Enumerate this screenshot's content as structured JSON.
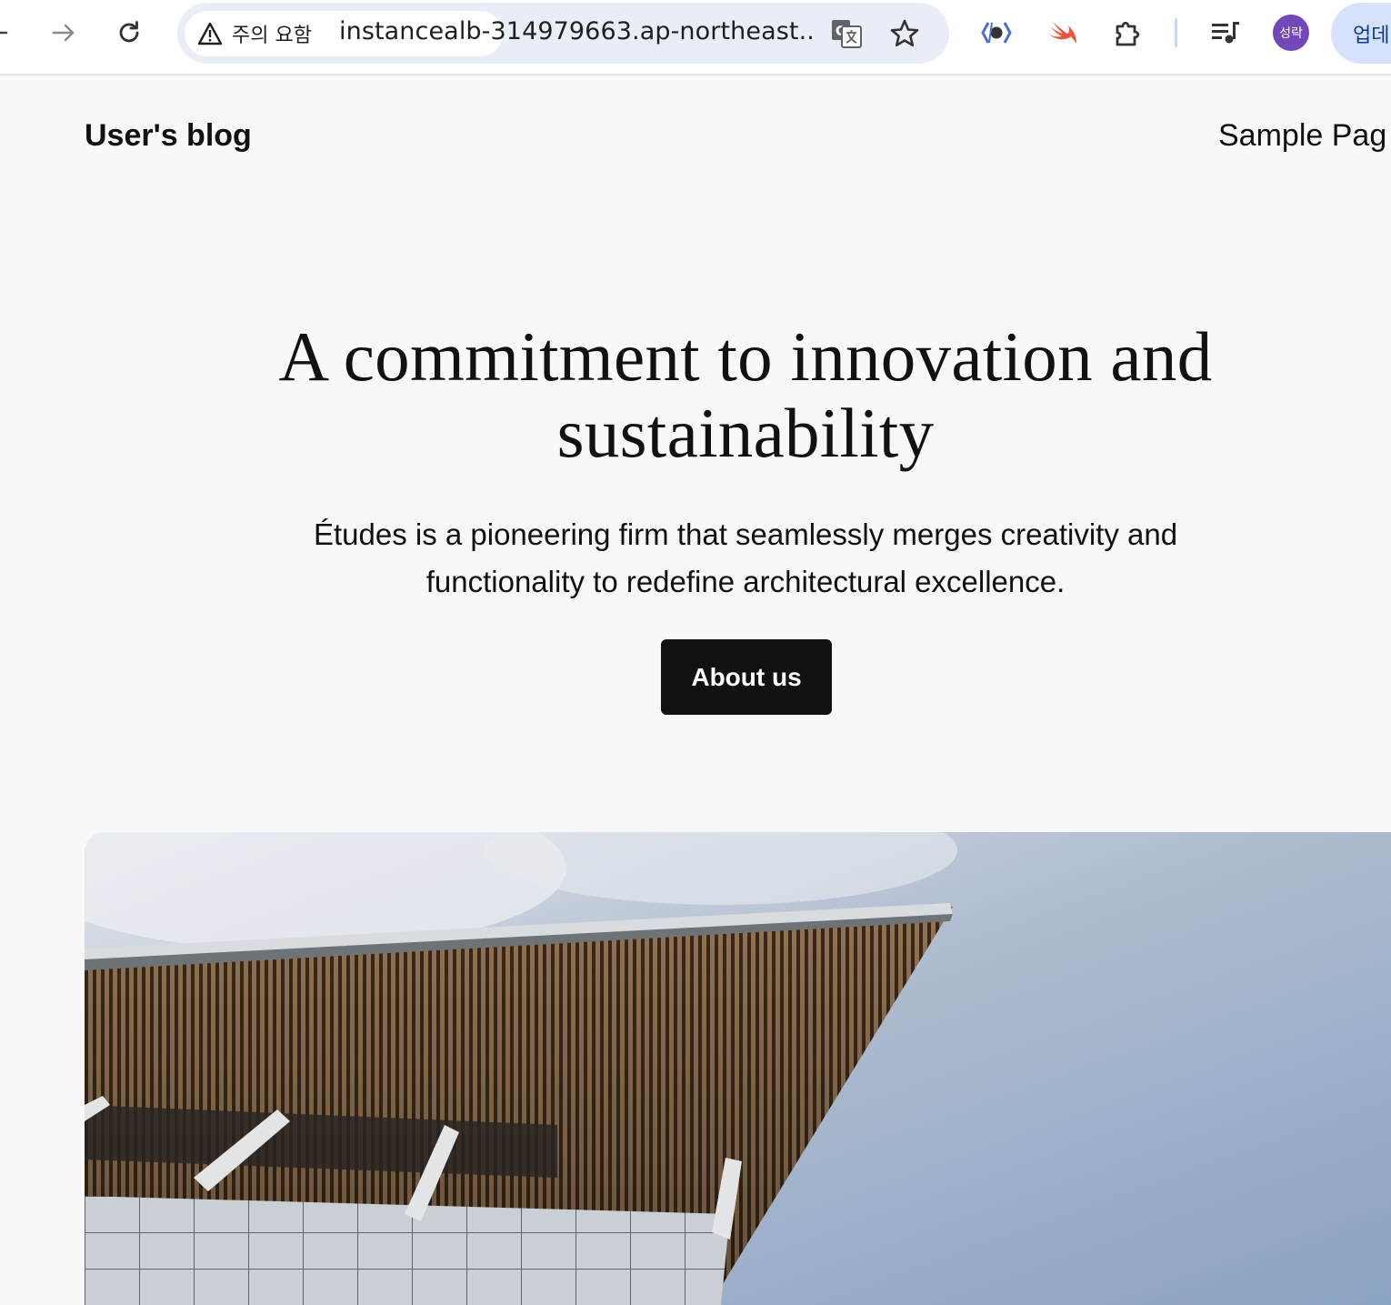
{
  "browser": {
    "security_chip": "주의 요함",
    "url": "instancealb-314979663.ap-northeast...",
    "profile_initials": "성락",
    "update_label": "업데"
  },
  "site": {
    "title": "User's blog",
    "nav": [
      "Sample Pag"
    ]
  },
  "hero": {
    "heading_line1": "A commitment to innovation and",
    "heading_line2": "sustainability",
    "text_line1": "Études is a pioneering firm that seamlessly merges creativity and",
    "text_line2": "functionality to redefine architectural excellence.",
    "button_label": "About us"
  },
  "colors": {
    "page_bg": "#f8f8f8",
    "button_bg": "#111111",
    "omnibox_bg": "#e9edf5",
    "avatar_bg": "#7447b8",
    "update_pill_bg": "#d6e2fb"
  },
  "icons": [
    "back-arrow-icon",
    "forward-arrow-icon",
    "reload-icon",
    "warning-icon",
    "translate-icon",
    "bookmark-star-icon",
    "extension-bracket-icon",
    "swift-icon",
    "puzzle-extensions-icon",
    "media-queue-icon"
  ]
}
